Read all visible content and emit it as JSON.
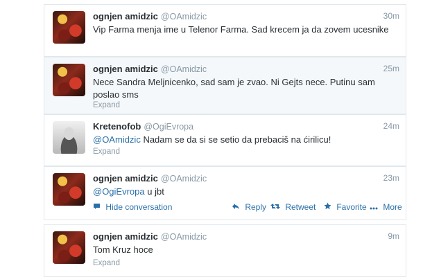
{
  "tweets": [
    {
      "name": "ognjen amidzic",
      "handle": "@OAmidzic",
      "time": "30m",
      "text": "Vip Farma menja ime u Telenor Farma. Sad krecem ja da zovem ucesnike"
    },
    {
      "name": "ognjen amidzic",
      "handle": "@OAmidzic",
      "time": "25m",
      "text": "Nece Sandra Meljnicenko, sad sam je zvao. Ni Gejts nece. Putinu sam poslao sms",
      "expand": "Expand"
    },
    {
      "name": "Kretenofob",
      "handle": "@OgiEvropa",
      "time": "24m",
      "mention": "@OAmidzic",
      "text": " Nadam se da si se setio da prebaciš na ćirilicu!",
      "expand": "Expand"
    },
    {
      "name": "ognjen amidzic",
      "handle": "@OAmidzic",
      "time": "23m",
      "mention": "@OgiEvropa",
      "text": " u jbt",
      "hide_conversation": "Hide conversation",
      "actions": {
        "reply": "Reply",
        "retweet": "Retweet",
        "favorite": "Favorite",
        "more": "More"
      }
    },
    {
      "name": "ognjen amidzic",
      "handle": "@OAmidzic",
      "time": "9m",
      "text": "Tom Kruz hoce",
      "expand": "Expand"
    }
  ],
  "icons": {
    "avatar_ogi": "avatar-ognjen",
    "avatar_kretenofob": "avatar-kretenofob",
    "hide_conversation": "speech-bubble-icon",
    "reply": "reply-arrow-icon",
    "retweet": "retweet-icon",
    "favorite": "star-icon",
    "more": "more-dots-icon"
  },
  "colors": {
    "link": "#2a6fa8",
    "meta": "#8899a6",
    "text": "#292f33",
    "border": "#e1e8ed",
    "expanded_bg": "#f5f8fa"
  }
}
